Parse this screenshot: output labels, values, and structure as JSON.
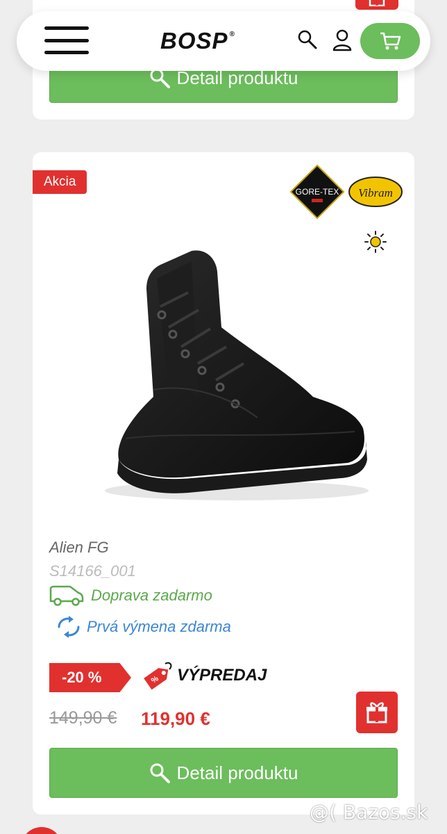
{
  "header": {
    "logo": "BOSP",
    "logo_mark": "®",
    "icons": [
      "menu-icon",
      "search-icon",
      "user-icon",
      "cart-icon"
    ]
  },
  "top_card": {
    "detail_button": "Detail produktu"
  },
  "product": {
    "badge": "Akcia",
    "brand_badges": [
      "GORE-TEX",
      "Vibram"
    ],
    "season_icon": "sun-icon",
    "name": "Alien FG",
    "code": "S14166_001",
    "features": {
      "shipping": "Doprava zadarmo",
      "exchange": "Prvá výmena zdarma"
    },
    "discount": "-20 %",
    "sale_label": "VÝPREDAJ",
    "old_price": "149,90 €",
    "new_price": "119,90 €",
    "detail_button": "Detail produktu",
    "gift_icon": "gift-icon"
  },
  "watermark": "@( Bazos.sk",
  "colors": {
    "accent_green": "#6cbd5c",
    "accent_red": "#e1312f",
    "link_blue": "#3b86d4"
  }
}
